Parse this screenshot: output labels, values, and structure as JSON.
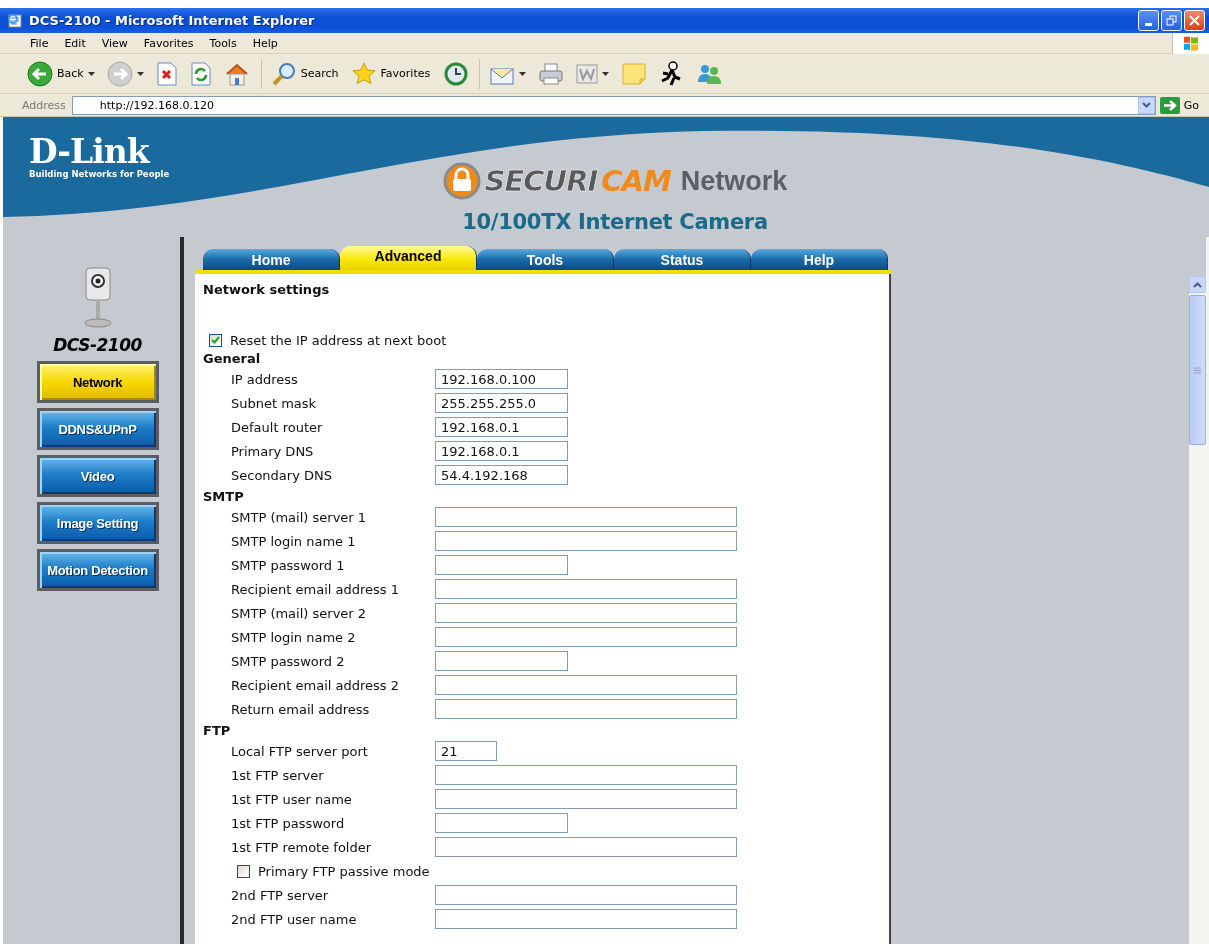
{
  "window": {
    "title": "DCS-2100 - Microsoft Internet Explorer"
  },
  "menu": [
    "File",
    "Edit",
    "View",
    "Favorites",
    "Tools",
    "Help"
  ],
  "toolbar": [
    {
      "kind": "back",
      "label": "Back",
      "dropdown": true
    },
    {
      "kind": "forward",
      "dropdown": true
    },
    {
      "kind": "stop",
      "dropdown": false
    },
    {
      "kind": "refresh",
      "dropdown": false
    },
    {
      "kind": "home",
      "dropdown": false
    },
    {
      "kind": "search",
      "label": "Search",
      "dropdown": false
    },
    {
      "kind": "favorites",
      "label": "Favorites",
      "dropdown": false
    },
    {
      "kind": "history",
      "dropdown": false
    },
    {
      "kind": "mail",
      "dropdown": true
    },
    {
      "kind": "print",
      "dropdown": false
    },
    {
      "kind": "edit",
      "dropdown": true
    },
    {
      "kind": "note",
      "dropdown": false
    },
    {
      "kind": "person",
      "dropdown": false
    },
    {
      "kind": "messenger",
      "dropdown": false
    }
  ],
  "address": {
    "label": "Address",
    "value": "http://192.168.0.120",
    "go": "Go"
  },
  "header": {
    "brand": "D-Link",
    "tagline": "Building Networks for People",
    "logo": [
      {
        "kind": "dark",
        "text": "SECURI"
      },
      {
        "kind": "accent",
        "text": "CAM"
      },
      {
        "kind": "plain",
        "text": "Network"
      }
    ],
    "subtitle": "10/100TX Internet Camera"
  },
  "model": "DCS-2100",
  "tabs": [
    {
      "label": "Home",
      "selected": false
    },
    {
      "label": "Advanced",
      "selected": true
    },
    {
      "label": "Tools",
      "selected": false
    },
    {
      "label": "Status",
      "selected": false
    },
    {
      "label": "Help",
      "selected": false
    }
  ],
  "side_menu": [
    {
      "label": "Network",
      "selected": true
    },
    {
      "label": "DDNS&UPnP",
      "selected": false
    },
    {
      "label": "Video",
      "selected": false
    },
    {
      "label": "Image Setting",
      "selected": false
    },
    {
      "label": "Motion Detection",
      "selected": false
    }
  ],
  "form": {
    "title": "Network settings",
    "options": [
      {
        "label": "Reset the IP address at next boot",
        "checked": true
      }
    ],
    "sections": [
      {
        "title": "General",
        "rows": [
          {
            "kind": "short_field",
            "label": "IP address",
            "value": "192.168.0.100"
          },
          {
            "kind": "short_field",
            "label": "Subnet mask",
            "value": "255.255.255.0"
          },
          {
            "kind": "short_field",
            "label": "Default router",
            "value": "192.168.0.1"
          },
          {
            "kind": "short_field",
            "label": "Primary DNS",
            "value": "192.168.0.1"
          },
          {
            "kind": "short_field",
            "label": "Secondary DNS",
            "value": "54.4.192.168"
          }
        ]
      },
      {
        "title": "SMTP",
        "rows": [
          {
            "kind": "long_field",
            "label": "SMTP (mail) server 1"
          },
          {
            "kind": "long_field",
            "label": "SMTP login name 1"
          },
          {
            "kind": "short_field",
            "label": "SMTP password 1"
          },
          {
            "kind": "long_field",
            "label": "Recipient email address 1"
          },
          {
            "kind": "long_field",
            "label": "SMTP (mail) server 2"
          },
          {
            "kind": "long_field",
            "label": "SMTP login name 2"
          },
          {
            "kind": "short_field",
            "label": "SMTP password 2"
          },
          {
            "kind": "long_field",
            "label": "Recipient email address 2"
          },
          {
            "kind": "long_field",
            "label": "Return email address"
          }
        ]
      },
      {
        "title": "FTP",
        "rows": [
          {
            "kind": "port_field",
            "label": "Local FTP server port",
            "value": "21"
          },
          {
            "kind": "long_field",
            "label": "1st FTP server"
          },
          {
            "kind": "long_field",
            "label": "1st FTP user name"
          },
          {
            "kind": "short_field",
            "label": "1st FTP password"
          },
          {
            "kind": "long_field",
            "label": "1st FTP remote folder"
          },
          {
            "kind": "checkbox",
            "label": "Primary FTP passive mode",
            "checked": false
          },
          {
            "kind": "long_field",
            "label": "2nd FTP server"
          },
          {
            "kind": "long_field",
            "label": "2nd FTP user name"
          }
        ]
      }
    ]
  }
}
